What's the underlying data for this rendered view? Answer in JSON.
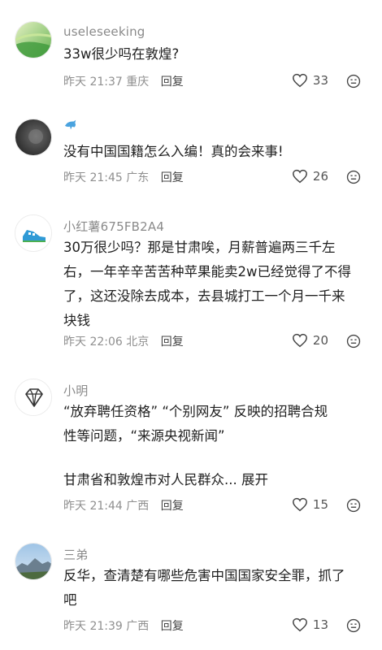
{
  "comments": [
    {
      "username": "useleseeking",
      "text": "33w很少吗在敦煌?",
      "time": "昨天 21:37",
      "location": "重庆",
      "reply_label": "回复",
      "likes": "33"
    },
    {
      "username": "",
      "text": "没有中国国籍怎么入编！真的会来事!",
      "time": "昨天 21:45",
      "location": "广东",
      "reply_label": "回复",
      "likes": "26"
    },
    {
      "username": "小红薯675FB2A4",
      "text_lines": [
        "30万很少吗？那是甘肃唉，月薪普遍两三千左",
        "右，一年辛辛苦苦种苹果能卖2w已经觉得了不得",
        "了，这还没除去成本，去县城打工一个月一千来",
        "块钱"
      ],
      "time": "昨天 22:06",
      "location": "北京",
      "reply_label": "回复",
      "likes": "20"
    },
    {
      "username": "小明",
      "text_lines": [
        "“放弃聘任资格” “个别网友” 反映的招聘合规",
        "性等问题，“来源央视新闻”"
      ],
      "text_tail": "甘肃省和敦煌市对人民群众...",
      "expand_label": "展开",
      "time": "昨天 21:44",
      "location": "广西",
      "reply_label": "回复",
      "likes": "15"
    },
    {
      "username": "三弟",
      "text_lines": [
        "反华，查清楚有哪些危害中国国家安全罪，抓了",
        "吧"
      ],
      "time": "昨天 21:39",
      "location": "广西",
      "reply_label": "回复",
      "likes": "13"
    }
  ]
}
